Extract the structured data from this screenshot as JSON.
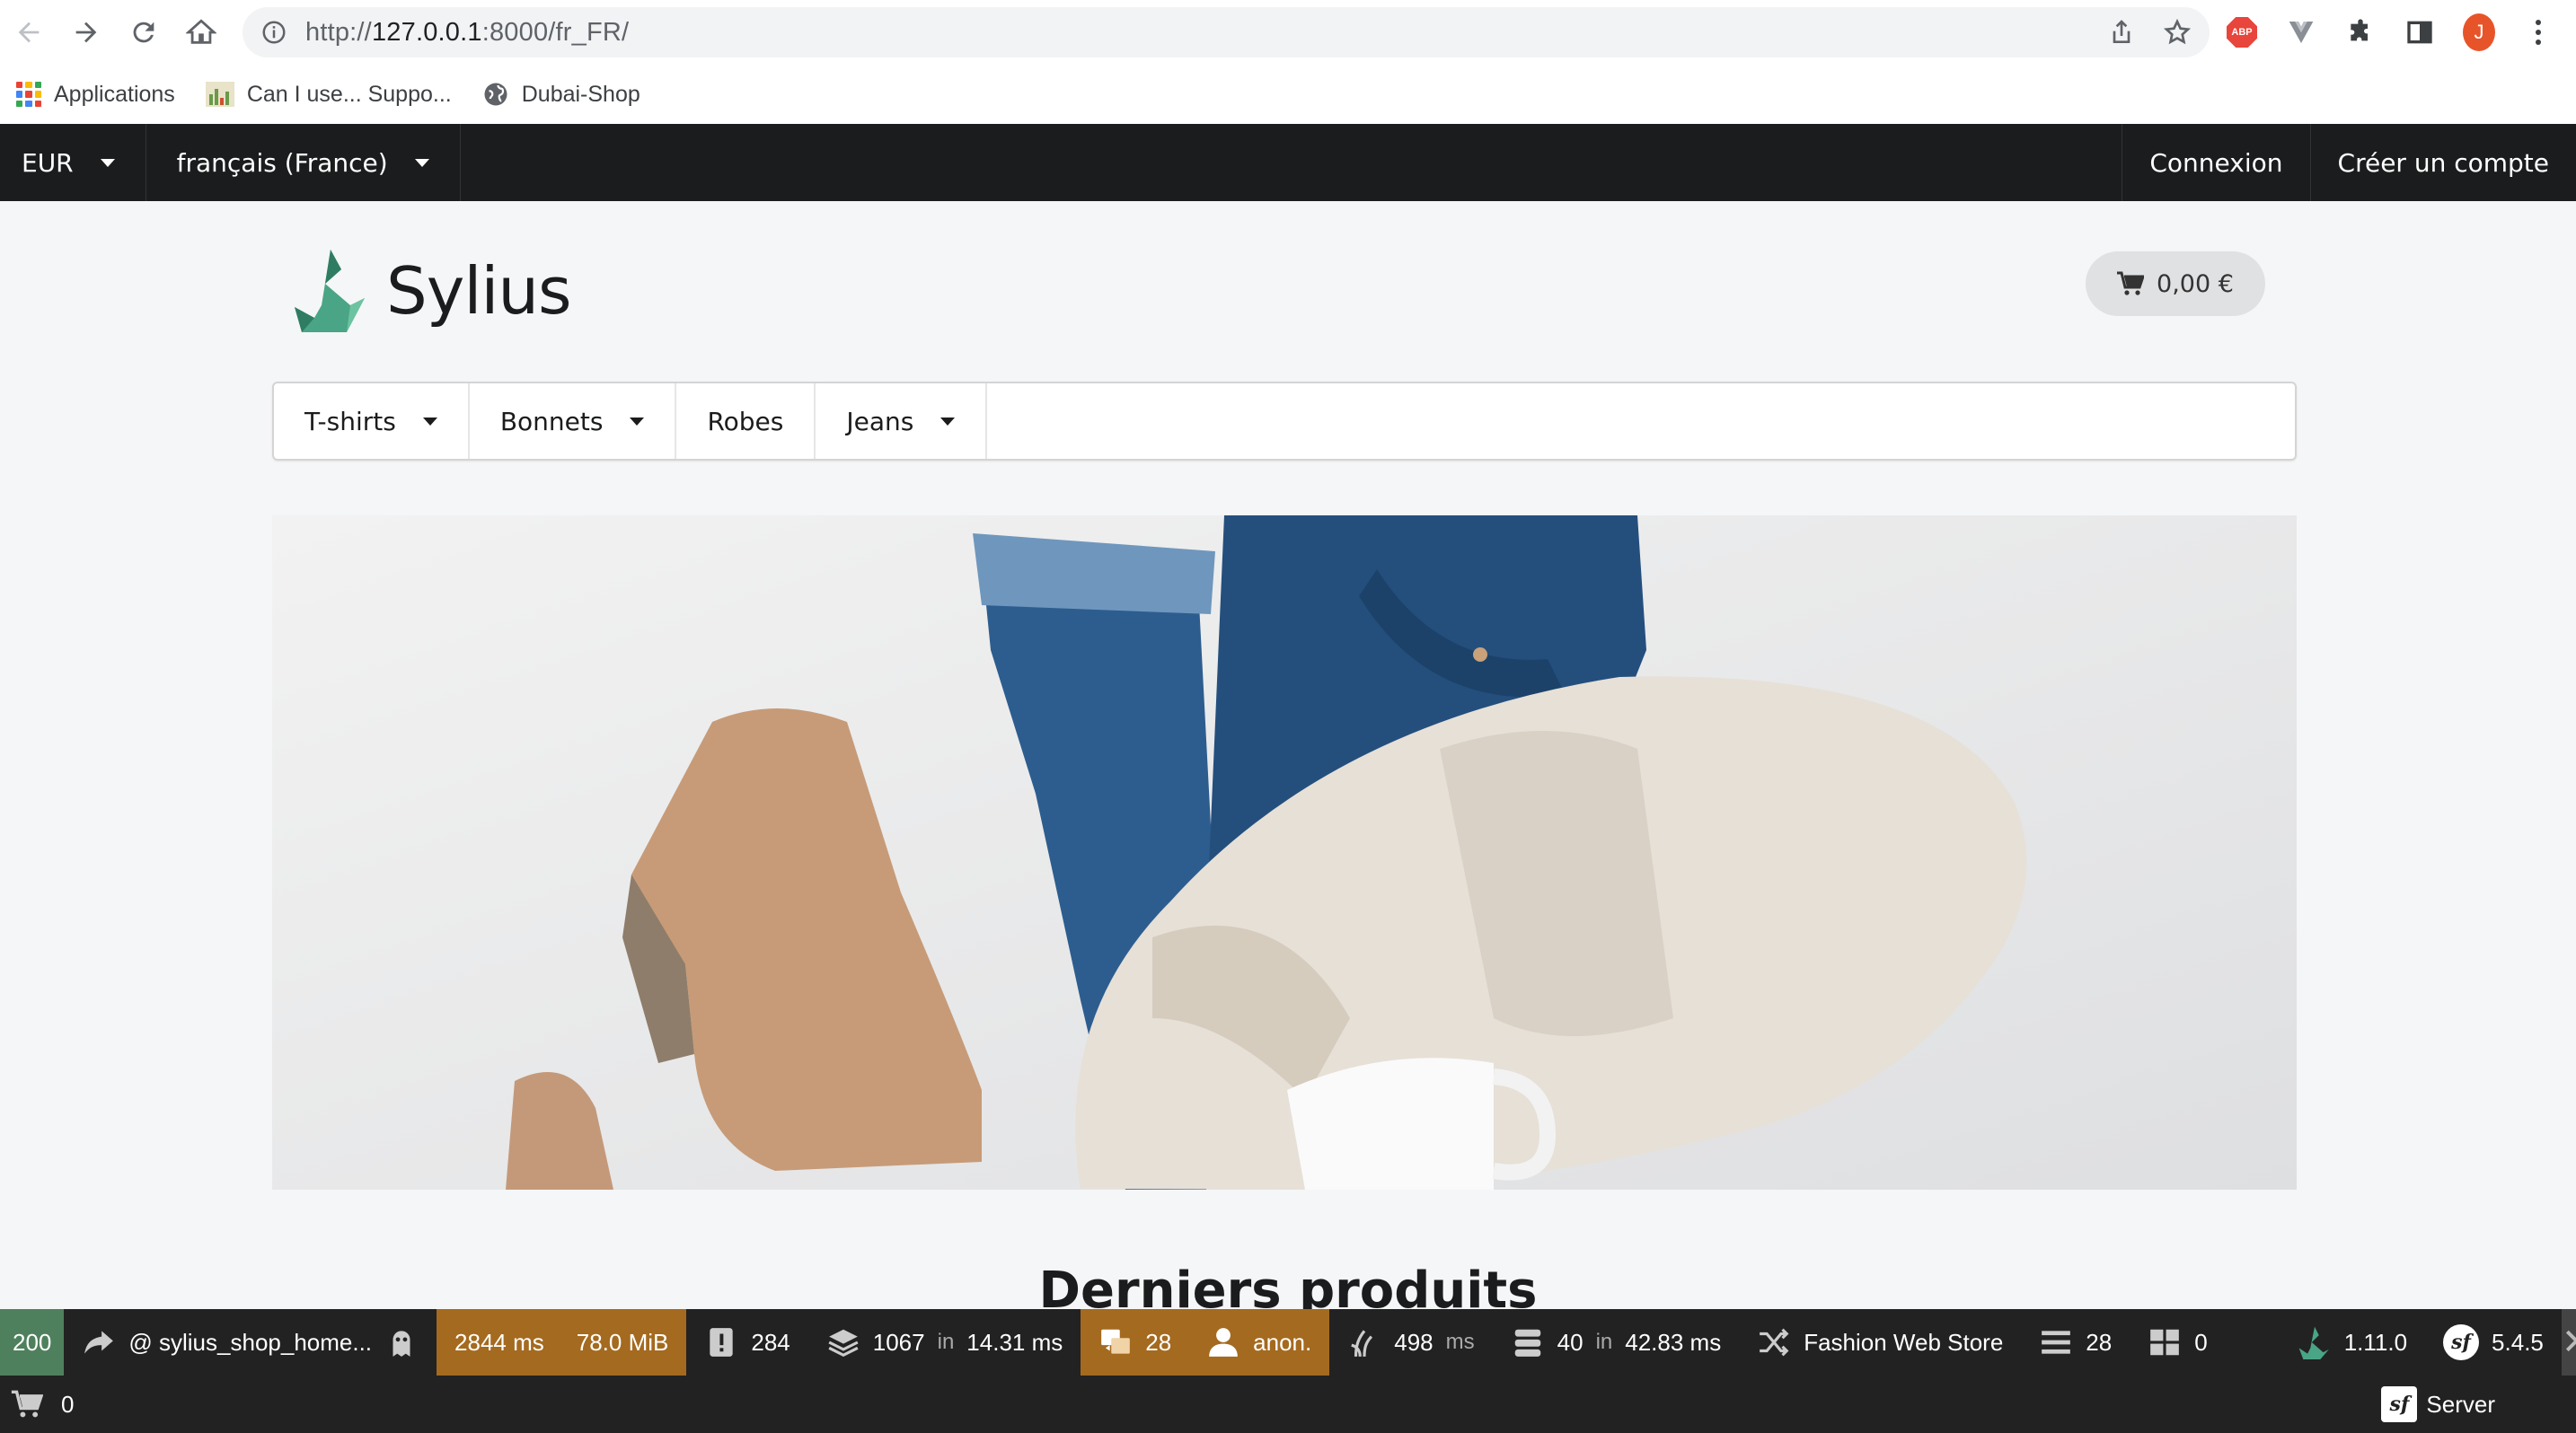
{
  "browser": {
    "url_prefix": "http://",
    "url_host": "127.0.0.1",
    "url_rest": ":8000/fr_FR/",
    "profile_initial": "J",
    "bookmarks": [
      {
        "label": "Applications",
        "icon": "apps-grid-icon"
      },
      {
        "label": "Can I use... Suppo...",
        "icon": "caniuse-icon"
      },
      {
        "label": "Dubai-Shop",
        "icon": "globe-icon"
      }
    ]
  },
  "topbar": {
    "currency": "EUR",
    "locale": "français (France)",
    "login": "Connexion",
    "register": "Créer un compte"
  },
  "header": {
    "logo_text": "Sylius",
    "cart_total": "0,00 €"
  },
  "menu": {
    "items": [
      {
        "label": "T-shirts",
        "has_dropdown": true
      },
      {
        "label": "Bonnets",
        "has_dropdown": true
      },
      {
        "label": "Robes",
        "has_dropdown": false
      },
      {
        "label": "Jeans",
        "has_dropdown": true
      }
    ]
  },
  "main": {
    "latest_products_title": "Derniers produits"
  },
  "debug_toolbar": {
    "status_code": "200",
    "route": "@ sylius_shop_home...",
    "time": "2844 ms",
    "memory": "78.0 MiB",
    "logs": "284",
    "cache_count": "1067",
    "cache_in": "in",
    "cache_time": "14.31 ms",
    "translations": "28",
    "user": "anon.",
    "twig_time": "498",
    "twig_unit": "ms",
    "db_queries": "40",
    "db_in": "in",
    "db_time": "42.83 ms",
    "channel": "Fashion Web Store",
    "events": "28",
    "forms": "0",
    "sylius_version": "1.11.0",
    "symfony_version": "5.4.5",
    "cart_items": "0",
    "server_label": "Server",
    "colors": {
      "status_ok": "#4f805d",
      "highlight": "#a46a1f",
      "background": "#222222"
    }
  }
}
